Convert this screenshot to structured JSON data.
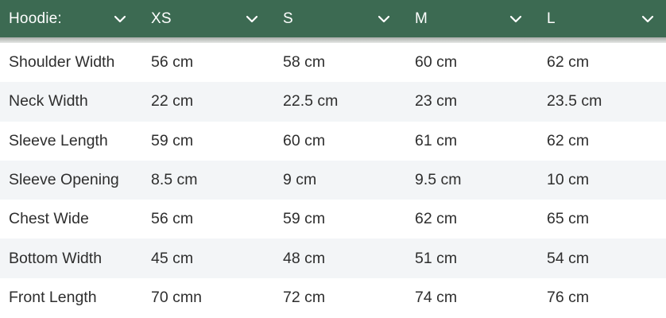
{
  "table": {
    "headers": [
      {
        "label": "Hoodie:",
        "icon": "chevron-down-icon"
      },
      {
        "label": "XS",
        "icon": "chevron-down-icon"
      },
      {
        "label": "S",
        "icon": "chevron-down-icon"
      },
      {
        "label": "M",
        "icon": "chevron-down-icon"
      },
      {
        "label": "L",
        "icon": "chevron-down-icon"
      }
    ],
    "rows": [
      {
        "label": "Shoulder Width",
        "values": [
          "56 cm",
          "58 cm",
          "60 cm",
          "62 cm"
        ]
      },
      {
        "label": "Neck Width",
        "values": [
          "22 cm",
          "22.5 cm",
          "23 cm",
          "23.5 cm"
        ]
      },
      {
        "label": "Sleeve Length",
        "values": [
          "59 cm",
          "60 cm",
          "61 cm",
          "62 cm"
        ]
      },
      {
        "label": "Sleeve Opening",
        "values": [
          "8.5 cm",
          "9 cm",
          "9.5 cm",
          "10 cm"
        ]
      },
      {
        "label": "Chest Wide",
        "values": [
          "56 cm",
          "59 cm",
          "62 cm",
          "65 cm"
        ]
      },
      {
        "label": "Bottom Width",
        "values": [
          "45 cm",
          "48 cm",
          "51 cm",
          "54 cm"
        ]
      },
      {
        "label": "Front Length",
        "values": [
          "70 cmn",
          "72 cm",
          "74 cm",
          "76 cm"
        ]
      }
    ]
  },
  "colors": {
    "header_bg": "#3c6a52",
    "header_text": "#ffffff",
    "stripe_bg": "#f3f5f7",
    "body_text": "#2e2e2e"
  }
}
